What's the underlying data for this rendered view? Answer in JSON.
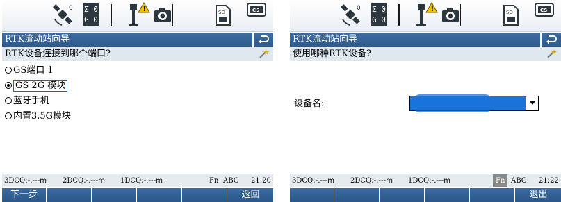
{
  "screens": [
    {
      "status_icons": {
        "sigma_rows": [
          "Σ 0",
          "G 0"
        ],
        "cs_label": "CS",
        "sd_label": "SD",
        "icons": [
          "satellite-icon",
          "antenna-warning-icon",
          "camera-icon",
          "sd-card-icon",
          "cs-card-icon"
        ]
      },
      "title": "RTK流动站向导",
      "question": "RTK设备连接到哪个端口?",
      "options": [
        {
          "label": "GS端口 1",
          "selected": false
        },
        {
          "label": "GS 2G 模块",
          "selected": true
        },
        {
          "label": "蓝牙手机",
          "selected": false
        },
        {
          "label": "内置3.5G模块",
          "selected": false
        }
      ],
      "status": {
        "dcq3_key": "3DCQ:",
        "dcq3_val": "-.---m",
        "dcq2_key": "2DCQ:",
        "dcq2_val": "-.---m",
        "dcq1_key": "1DCQ:",
        "dcq1_val": "-.---m",
        "fn": "Fn",
        "abc": "ABC",
        "time": "21:20"
      },
      "softkeys": [
        "下一步",
        "",
        "",
        "",
        "",
        "返回"
      ]
    },
    {
      "status_icons": {
        "sigma_rows": [
          "Σ 0",
          "G 0"
        ],
        "cs_label": "CS",
        "sd_label": "SD",
        "icons": [
          "satellite-icon",
          "antenna-warning-icon",
          "camera-icon",
          "sd-card-icon",
          "cs-card-icon"
        ]
      },
      "title": "RTK流动站向导",
      "question": "使用哪种RTK设备?",
      "field": {
        "label": "设备名:",
        "value_redacted": true
      },
      "status": {
        "dcq3_key": "3DCQ:",
        "dcq3_val": "-.---m",
        "dcq2_key": "2DCQ:",
        "dcq2_val": "-.---m",
        "dcq1_key": "1DCQ:",
        "dcq1_val": "-.---m",
        "fn": "Fn",
        "abc": "ABC",
        "time": "21:22"
      },
      "softkeys": [
        "",
        "",
        "",
        "",
        "",
        "退出"
      ]
    }
  ]
}
